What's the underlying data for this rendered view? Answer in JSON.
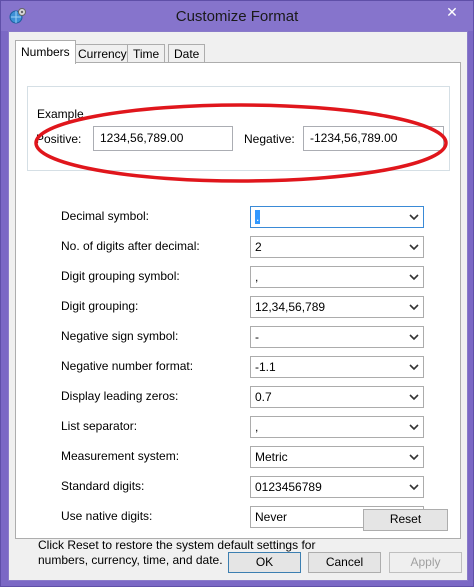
{
  "window": {
    "title": "Customize Format",
    "close_glyph": "✕"
  },
  "tabs": [
    {
      "label": "Numbers",
      "active": true
    },
    {
      "label": "Currency",
      "active": false
    },
    {
      "label": "Time",
      "active": false
    },
    {
      "label": "Date",
      "active": false
    }
  ],
  "example": {
    "legend": "Example",
    "positive_label": "Positive:",
    "positive_value": "1234,56,789.00",
    "negative_label": "Negative:",
    "negative_value": "-1234,56,789.00"
  },
  "settings": [
    {
      "label": "Decimal symbol:",
      "value": "."
    },
    {
      "label": "No. of digits after decimal:",
      "value": "2"
    },
    {
      "label": "Digit grouping symbol:",
      "value": ","
    },
    {
      "label": "Digit grouping:",
      "value": "12,34,56,789"
    },
    {
      "label": "Negative sign symbol:",
      "value": "-"
    },
    {
      "label": "Negative number format:",
      "value": "-1.1"
    },
    {
      "label": "Display leading zeros:",
      "value": "0.7"
    },
    {
      "label": "List separator:",
      "value": ","
    },
    {
      "label": "Measurement system:",
      "value": "Metric"
    },
    {
      "label": "Standard digits:",
      "value": "0123456789"
    },
    {
      "label": "Use native digits:",
      "value": "Never"
    }
  ],
  "reset_note": "Click Reset to restore the system default settings for numbers, currency, time, and date.",
  "buttons": {
    "reset": "Reset",
    "ok": "OK",
    "cancel": "Cancel",
    "apply": "Apply"
  },
  "colors": {
    "title_bar": "#8674cc",
    "annotation_ellipse": "#e0161c",
    "focus_border": "#3a8ad6"
  },
  "icons": {
    "app": "globe-gear-icon",
    "close": "close-icon",
    "dropdown": "chevron-down-icon"
  }
}
